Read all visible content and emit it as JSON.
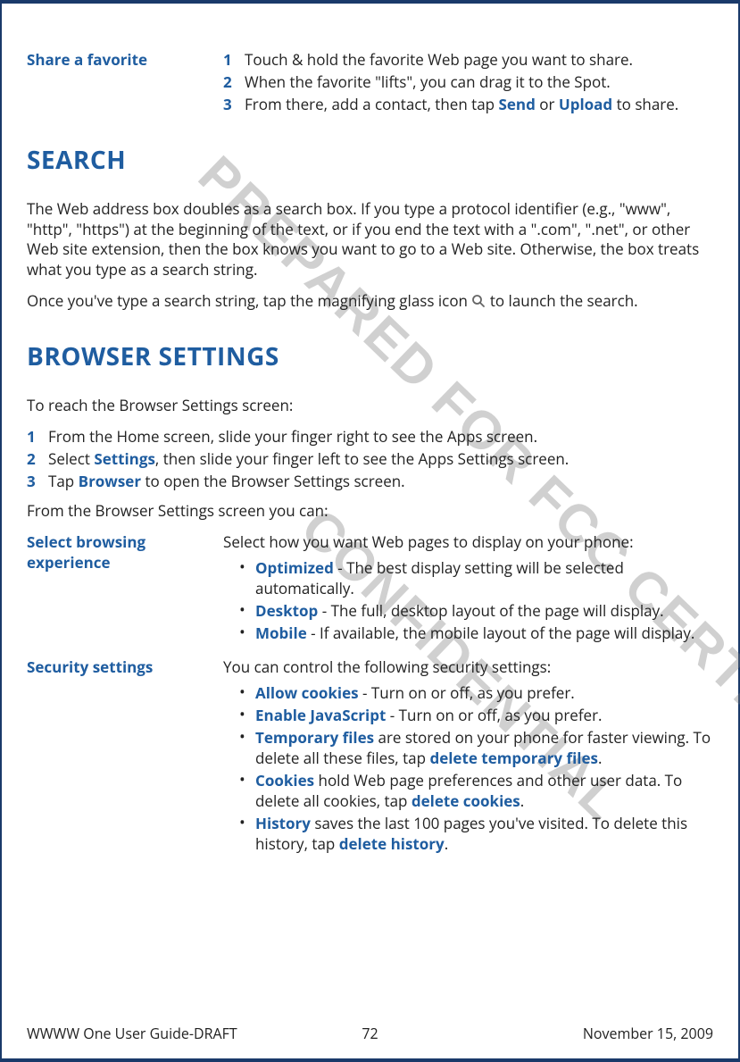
{
  "watermark1": "PREPARED FOR FCC CERTIFICATION",
  "watermark2": "CONFIDENTIAL",
  "share": {
    "term": "Share a favorite",
    "steps": [
      "Touch & hold the favorite Web page you want to share.",
      "When the favorite \"lifts\", you can drag it to the Spot."
    ],
    "step3_pre": "From there, add a contact, then tap ",
    "step3_b1": "Send",
    "step3_mid": " or ",
    "step3_b2": "Upload",
    "step3_post": " to share."
  },
  "nums": {
    "n1": "1",
    "n2": "2",
    "n3": "3"
  },
  "search": {
    "heading": "SEARCH",
    "p1": "The Web address box doubles as a search box. If you type a protocol identifier (e.g., \"www\", \"http\", \"https\") at the beginning of the text, or if you end the text with a \".com\", \".net\", or other Web site extension, then the box knows you want to go to a Web site. Otherwise, the box treats what you type as a search string.",
    "p2_pre": "Once you've type a search string, tap the magnifying glass icon ",
    "p2_post": " to launch the search."
  },
  "browser": {
    "heading": "BROWSER SETTINGS",
    "intro": "To reach the Browser Settings screen:",
    "steps": {
      "s1": "From the Home screen, slide your finger right to see the Apps screen.",
      "s2_pre": "Select ",
      "s2_b": "Settings",
      "s2_post": ", then slide your finger left to see the Apps Settings screen.",
      "s3_pre": "Tap ",
      "s3_b": "Browser",
      "s3_post": " to open the Browser Settings screen."
    },
    "from": "From the Browser Settings screen you can:"
  },
  "experience": {
    "term": "Select browsing experience",
    "intro": "Select how you want Web pages to display on your phone:",
    "items": {
      "opt_b": "Optimized",
      "opt_t": " - The best display setting will be selected automatically.",
      "desk_b": "Desktop",
      "desk_t": " - The full, desktop layout of the page will display.",
      "mob_b": "Mobile",
      "mob_t": " - If available, the mobile layout of the page will display."
    }
  },
  "security": {
    "term": "Security settings",
    "intro": "You can control the following security settings:",
    "items": {
      "cook_b": "Allow cookies",
      "cook_t": " - Turn on or off, as you prefer.",
      "js_b": "Enable JavaScript",
      "js_t": " - Turn on or off, as you prefer.",
      "tmp_b": "Temporary files",
      "tmp_t1": " are stored on your phone for faster viewing. To delete all these files, tap ",
      "tmp_b2": "delete temporary files",
      "tmp_t2": ".",
      "ck_b": "Cookies",
      "ck_t1": " hold Web page preferences and other user data. To delete all cookies, tap ",
      "ck_b2": "delete cookies",
      "ck_t2": ".",
      "hist_b": "History",
      "hist_t1": " saves the last 100 pages you've visited. To delete this history, tap ",
      "hist_b2": "delete history",
      "hist_t2": "."
    }
  },
  "footer": {
    "left": "WWWW One User Guide-DRAFT",
    "center": "72",
    "right": "November 15, 2009"
  }
}
